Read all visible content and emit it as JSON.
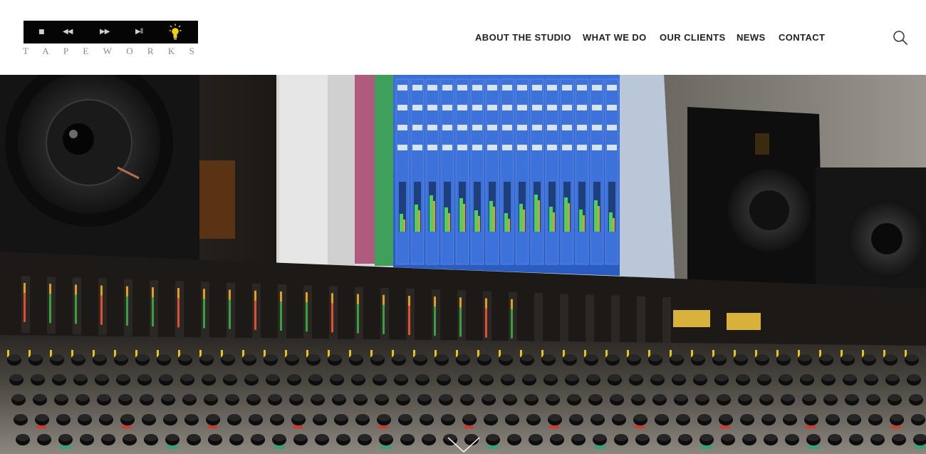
{
  "site": {
    "logo_text": "TAPEWORKS",
    "transport_icons": [
      "stop-icon",
      "rewind-icon",
      "fast-forward-icon",
      "play-pause-icon",
      "lightbulb-icon"
    ]
  },
  "nav": {
    "items": [
      {
        "label": "ABOUT THE STUDIO"
      },
      {
        "label": "WHAT WE DO"
      },
      {
        "label": "OUR CLIENTS"
      },
      {
        "label": "NEWS"
      },
      {
        "label": "CONTACT"
      }
    ],
    "search_icon": "search-icon"
  },
  "hero": {
    "image": "recording studio mixing console with monitors",
    "scroll_icon": "chevron-down-icon"
  },
  "colors": {
    "header_bg": "#ffffff",
    "nav_text": "#222222",
    "logo_bar": "#050505",
    "bulb_yellow": "#f2d10a",
    "daw_blue": "#2f63c9"
  }
}
